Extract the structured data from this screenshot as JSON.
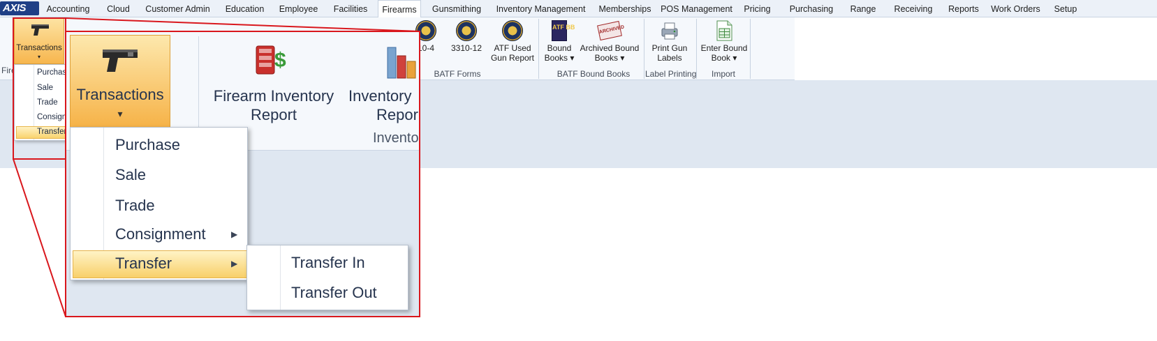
{
  "app": {
    "logo": "AXIS"
  },
  "menu": {
    "tabs": [
      {
        "label": "Accounting"
      },
      {
        "label": "Cloud"
      },
      {
        "label": "Customer Admin"
      },
      {
        "label": "Education"
      },
      {
        "label": "Employee"
      },
      {
        "label": "Facilities"
      },
      {
        "label": "Firearms"
      },
      {
        "label": "Gunsmithing"
      },
      {
        "label": "Inventory Management"
      },
      {
        "label": "Memberships"
      },
      {
        "label": "POS Management"
      },
      {
        "label": "Pricing"
      },
      {
        "label": "Purchasing"
      },
      {
        "label": "Range"
      },
      {
        "label": "Receiving"
      },
      {
        "label": "Reports"
      },
      {
        "label": "Work Orders"
      },
      {
        "label": "Setup"
      }
    ],
    "active": "Firearms"
  },
  "ribbon": {
    "transactions": "Transactions",
    "group_fire": "Fire",
    "form_3310_4": "10-4",
    "form_3310_12": "3310-12",
    "atf_used_1": "ATF Used",
    "atf_used_2": "Gun Report",
    "batf_forms": "BATF Forms",
    "bound_books_1": "Bound",
    "bound_books_2": "Books",
    "archived_1": "Archived Bound",
    "archived_2": "Books",
    "batf_bound_books": "BATF Bound Books",
    "print_labels_1": "Print Gun",
    "print_labels_2": "Labels",
    "label_printing": "Label Printing",
    "enter_bound_1": "Enter Bound",
    "enter_bound_2": "Book",
    "import": "Import",
    "atf_bb_icon_text": "ATF BB",
    "archived_icon_text": "ARCHIVED"
  },
  "small_dropdown": {
    "items": [
      "Purchase",
      "Sale",
      "Trade",
      "Consign",
      "Transfer"
    ]
  },
  "zoom": {
    "transactions": "Transactions",
    "firearm_inventory_1": "Firearm Inventory",
    "firearm_inventory_2": "Report",
    "inventory_1": "Inventory",
    "inventory_2": "Repor",
    "inventory_group": "Invento",
    "menu_items": [
      "Purchase",
      "Sale",
      "Trade",
      "Consignment",
      "Transfer"
    ],
    "submenu_items": [
      "Transfer In",
      "Transfer Out"
    ]
  },
  "colors": {
    "highlight": "#f8d06a",
    "callout": "#d9171d",
    "ribbon_bg": "#f5f8fc",
    "workspace": "#dfe7f1"
  }
}
